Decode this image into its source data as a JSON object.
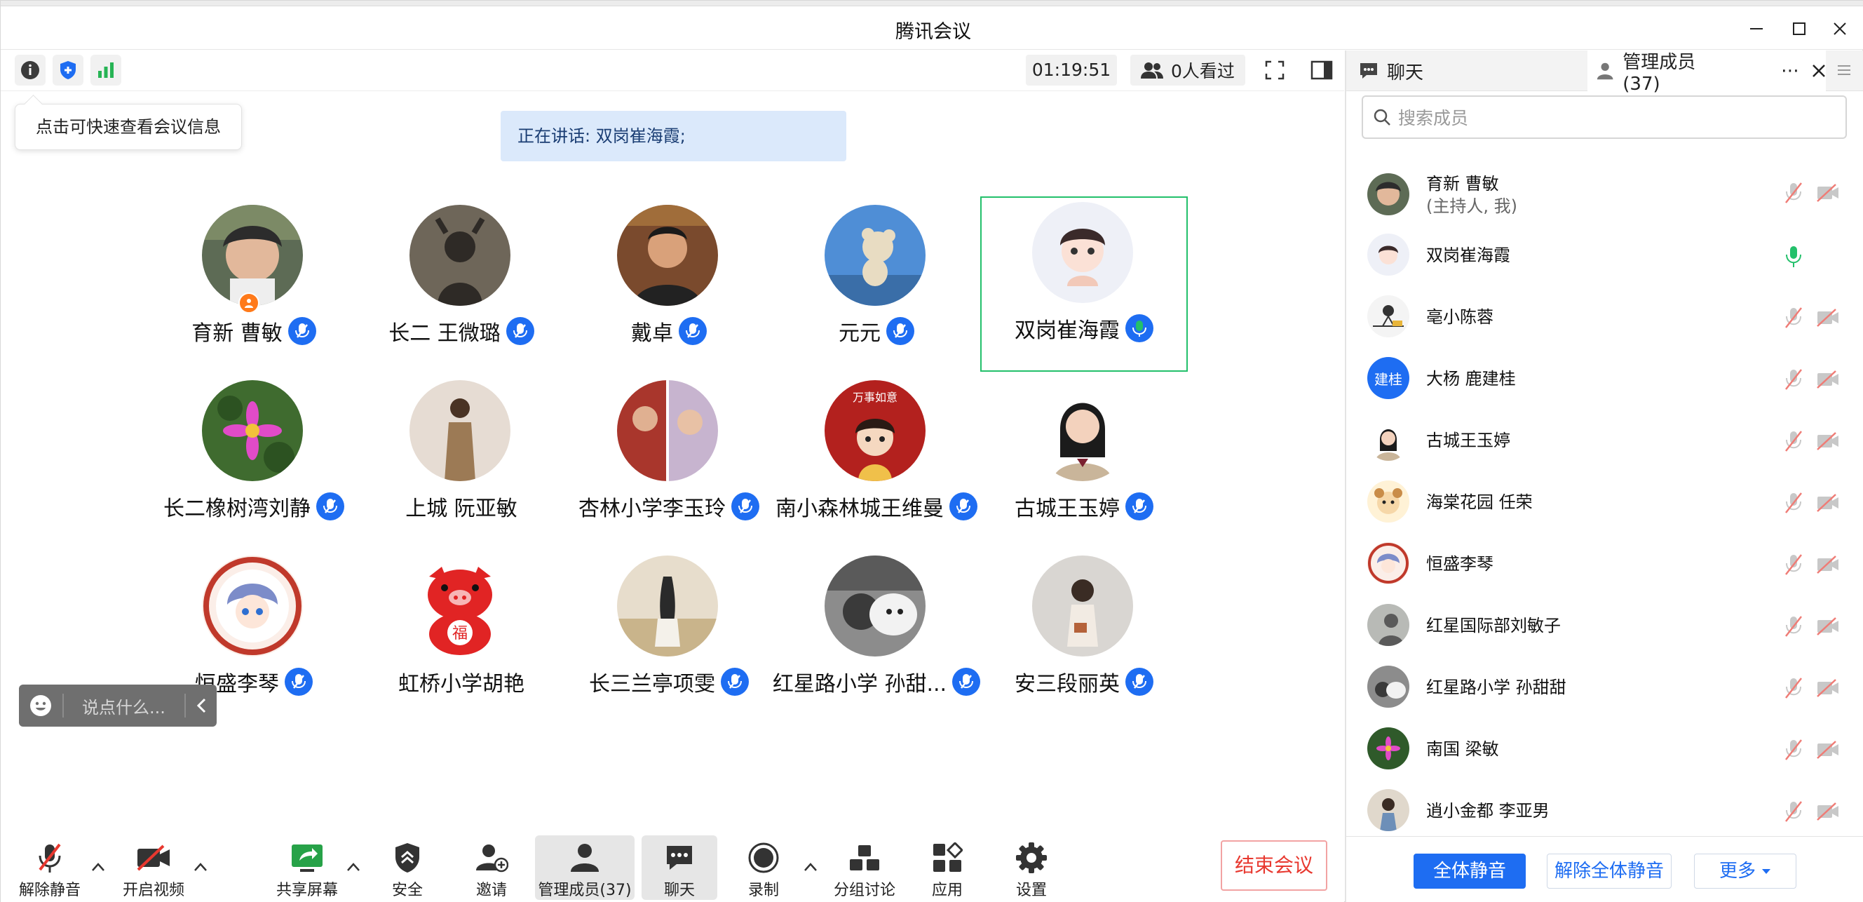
{
  "window": {
    "title": "腾讯会议"
  },
  "meeting_toolbar": {
    "timer": "01:19:51",
    "viewers": "0人看过"
  },
  "tooltip": {
    "text": "点击可快速查看会议信息"
  },
  "speaking": {
    "text": "正在讲话: 双岗崔海霞;"
  },
  "participants": [
    {
      "name": "育新 曹敏",
      "mic": "on",
      "host": true
    },
    {
      "name": "长二 王微璐",
      "mic": "on"
    },
    {
      "name": "戴卓",
      "mic": "on"
    },
    {
      "name": "元元",
      "mic": "on"
    },
    {
      "name": "双岗崔海霞",
      "mic": "speaking",
      "active": true
    },
    {
      "name": "长二橡树湾刘静",
      "mic": "on"
    },
    {
      "name": "上城 阮亚敏",
      "mic": "none"
    },
    {
      "name": "杏林小学李玉玲",
      "mic": "on"
    },
    {
      "name": "南小森林城王维曼",
      "mic": "on"
    },
    {
      "name": "古城王玉婷",
      "mic": "on"
    },
    {
      "name": "恒盛李琴",
      "mic": "on"
    },
    {
      "name": "虹桥小学胡艳",
      "mic": "none"
    },
    {
      "name": "长三兰亭项雯",
      "mic": "on"
    },
    {
      "name": "红星路小学 孙甜...",
      "mic": "on"
    },
    {
      "name": "安三段丽英",
      "mic": "on"
    }
  ],
  "avatar_card_text": "万事如意",
  "avatar_fu_text": "福",
  "chat_input": {
    "placeholder": "说点什么..."
  },
  "bottom_toolbar": {
    "unmute": "解除静音",
    "video": "开启视频",
    "share": "共享屏幕",
    "security": "安全",
    "invite": "邀请",
    "members": "管理成员(37)",
    "chat": "聊天",
    "record": "录制",
    "breakout": "分组讨论",
    "apps": "应用",
    "settings": "设置",
    "end_meeting": "结束会议"
  },
  "side_panel": {
    "tab_chat": "聊天",
    "tab_members": "管理成员(37)",
    "search_placeholder": "搜索成员",
    "members": [
      {
        "name": "育新 曹敏",
        "sub": "(主持人, 我)",
        "mic": "muted"
      },
      {
        "name": "双岗崔海霞",
        "mic": "speaking"
      },
      {
        "name": "亳小陈蓉",
        "mic": "muted"
      },
      {
        "name": "大杨 鹿建桂",
        "mic": "muted",
        "initials": "建桂"
      },
      {
        "name": "古城王玉婷",
        "mic": "muted"
      },
      {
        "name": "海棠花园 任荣",
        "mic": "muted"
      },
      {
        "name": "恒盛李琴",
        "mic": "muted"
      },
      {
        "name": "红星国际部刘敏子",
        "mic": "muted"
      },
      {
        "name": "红星路小学 孙甜甜",
        "mic": "muted"
      },
      {
        "name": "南国 梁敏",
        "mic": "muted"
      },
      {
        "name": "逍小金都 李亚男",
        "mic": "muted"
      }
    ],
    "footer": {
      "mute_all": "全体静音",
      "unmute_all": "解除全体静音",
      "more": "更多"
    }
  },
  "colors": {
    "accent": "#1e6df2",
    "speaking": "#23c06b",
    "danger": "#e8382f",
    "banner": "#dbe9fb"
  }
}
